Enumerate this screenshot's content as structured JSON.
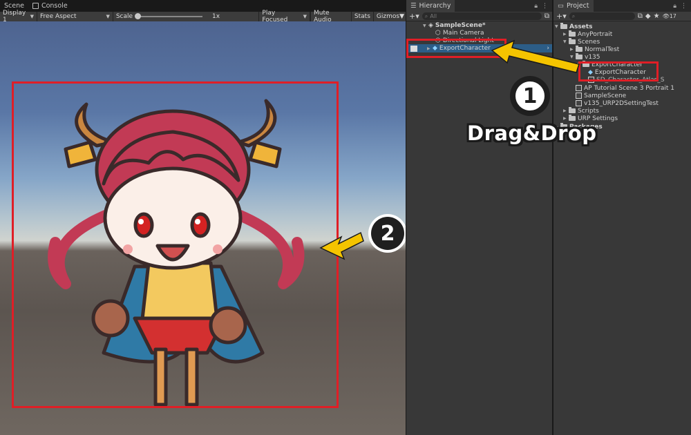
{
  "scene_panel": {
    "tabs": [
      {
        "label": "Scene"
      },
      {
        "label": "Console"
      }
    ],
    "toolbar": {
      "display": "Display 1",
      "aspect": "Free Aspect",
      "scale_label": "Scale",
      "scale_value": "1x",
      "play_mode": "Play Focused",
      "mute_audio": "Mute Audio",
      "stats": "Stats",
      "gizmos": "Gizmos"
    }
  },
  "hierarchy": {
    "tab_label": "Hierarchy",
    "search_placeholder": "All",
    "scene_name": "SampleScene*",
    "items": [
      {
        "label": "Main Camera"
      },
      {
        "label": "Directional Light"
      },
      {
        "label": "ExportCharacter"
      }
    ]
  },
  "project": {
    "tab_label": "Project",
    "hidden_count": "17",
    "tree": [
      {
        "label": "Assets"
      },
      {
        "label": "AnyPortrait"
      },
      {
        "label": "Scenes"
      },
      {
        "label": "NormalTest"
      },
      {
        "label": "v135"
      },
      {
        "label": "ExportCharacter"
      },
      {
        "label": "ExportCharacter"
      },
      {
        "label": "SD_Character_Atlas_S"
      },
      {
        "label": "AP Tutorial Scene 3 Portrait 1"
      },
      {
        "label": "SampleScene"
      },
      {
        "label": "v135_URP2DSettingTest"
      },
      {
        "label": "Scripts"
      },
      {
        "label": "URP Settings"
      },
      {
        "label": "Packages"
      }
    ]
  },
  "annotations": {
    "step1": "1",
    "step2": "2",
    "caption": "Drag&Drop",
    "highlight_color": "#e01e26",
    "arrow_color": "#f5c400"
  }
}
